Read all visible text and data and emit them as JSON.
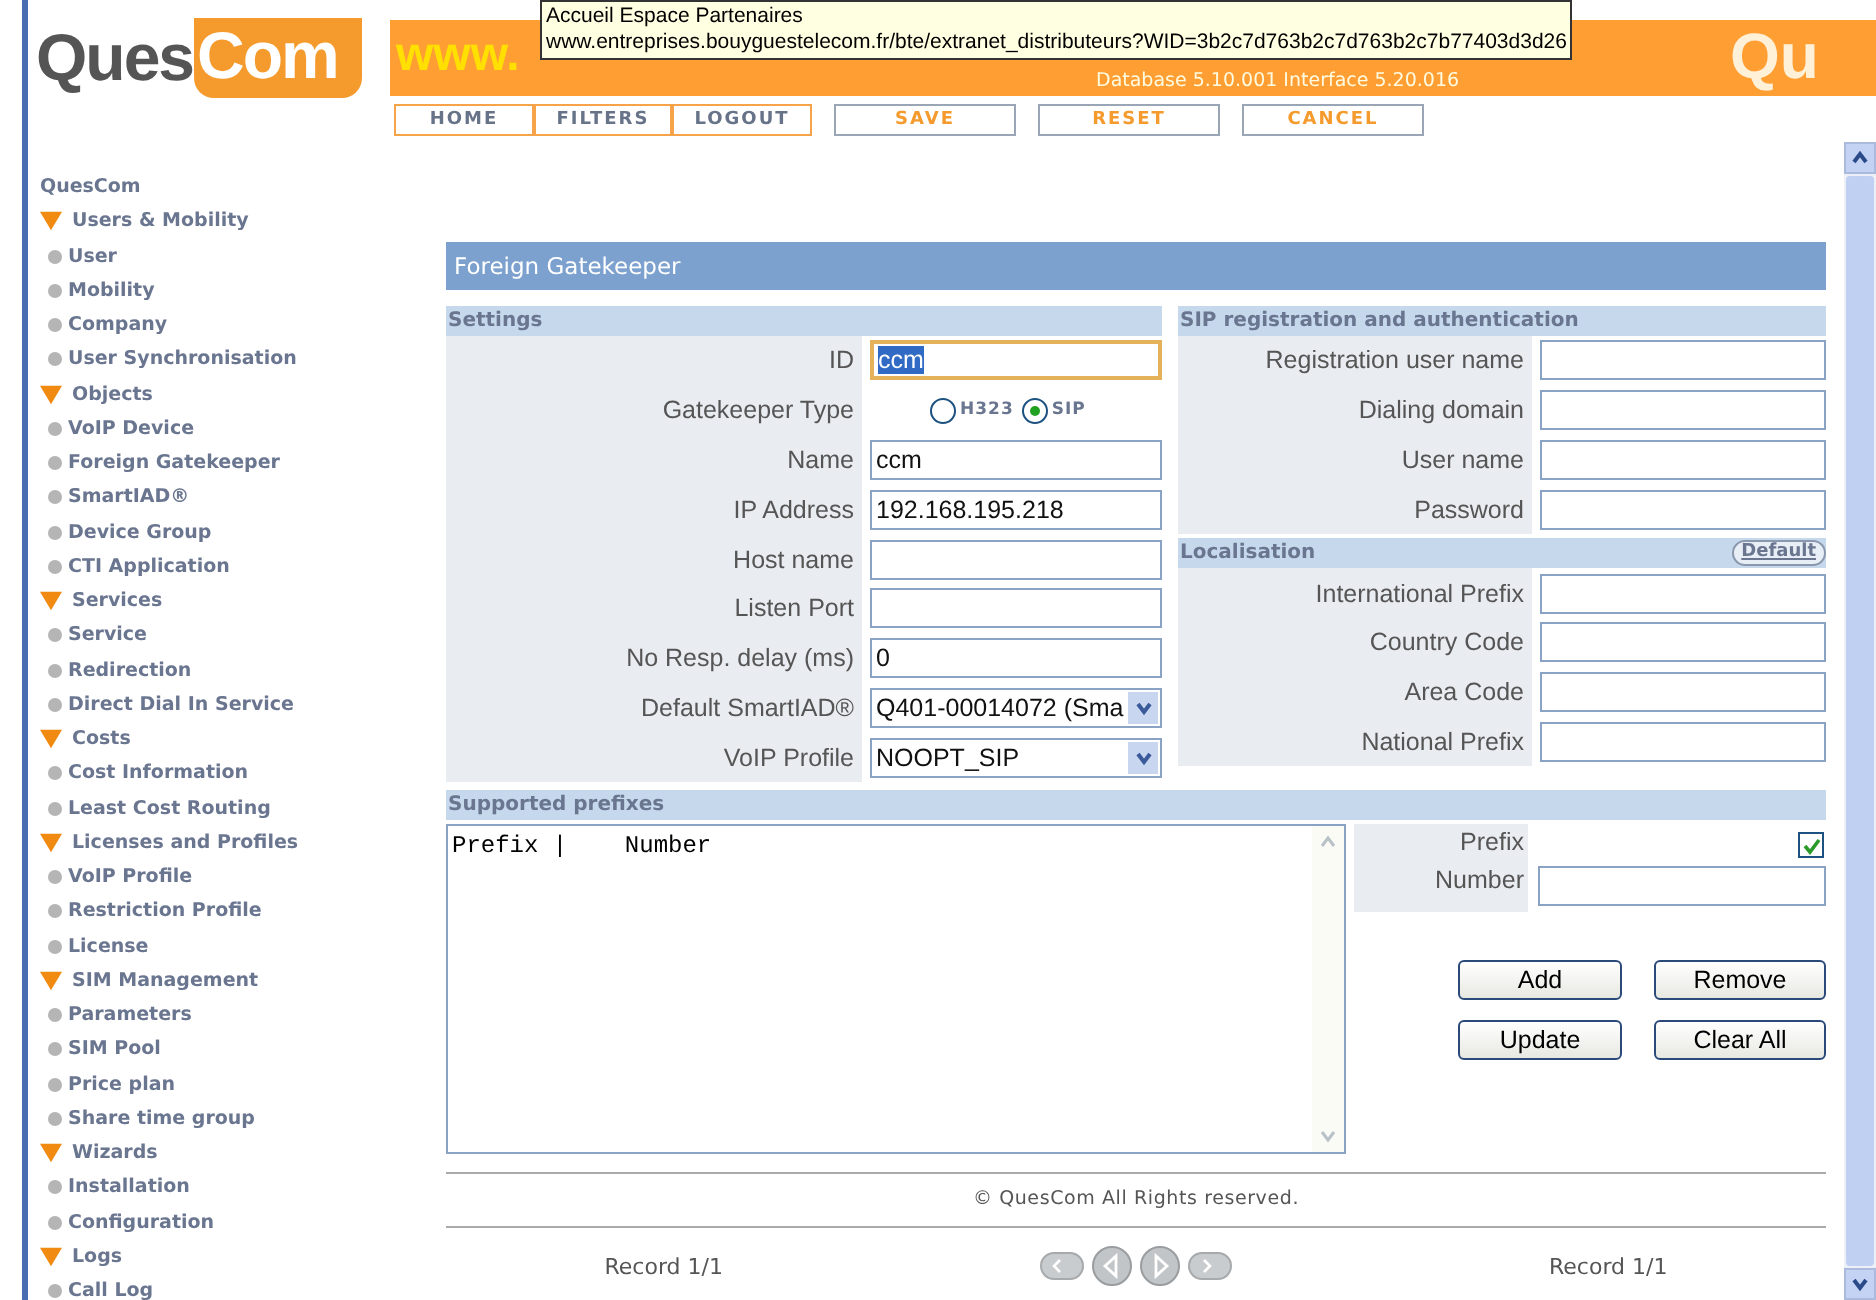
{
  "logo": {
    "first": "Ques",
    "second": "Com"
  },
  "banner": {
    "site": "www.",
    "version": "Database 5.10.001  Interface 5.20.016",
    "watermark": "Qu"
  },
  "tooltip": {
    "lines": [
      "Accueil Espace Partenaires",
      "www.entreprises.bouyguestelecom.fr/bte/extranet_distributeurs?WID=3b2c7d763b2c7d763b2c7b77403d3d26"
    ]
  },
  "nav": [
    {
      "label": "HOME",
      "kind": "nav"
    },
    {
      "label": "FILTERS",
      "kind": "nav"
    },
    {
      "label": "LOGOUT",
      "kind": "nav"
    },
    {
      "label": "SAVE",
      "kind": "action"
    },
    {
      "label": "RESET",
      "kind": "action"
    },
    {
      "label": "CANCEL",
      "kind": "action"
    }
  ],
  "sidebar": {
    "root": "QuesCom",
    "groups": [
      {
        "label": "Users & Mobility",
        "expanded": true,
        "items": [
          "User",
          "Mobility",
          "Company",
          "User Synchronisation"
        ]
      },
      {
        "label": "Objects",
        "expanded": true,
        "items": [
          "VoIP Device",
          "Foreign Gatekeeper",
          "SmartIAD®",
          "Device Group",
          "CTI Application"
        ]
      },
      {
        "label": "Services",
        "expanded": true,
        "items": [
          "Service",
          "Redirection",
          "Direct Dial In Service"
        ]
      },
      {
        "label": "Costs",
        "expanded": true,
        "items": [
          "Cost Information",
          "Least Cost Routing"
        ]
      },
      {
        "label": "Licenses and Profiles",
        "expanded": true,
        "items": [
          "VoIP Profile",
          "Restriction Profile",
          "License"
        ]
      },
      {
        "label": "SIM Management",
        "expanded": true,
        "items": [
          "Parameters",
          "SIM Pool",
          "Price plan",
          "Share time group"
        ]
      },
      {
        "label": "Wizards",
        "expanded": true,
        "items": [
          "Installation",
          "Configuration"
        ]
      },
      {
        "label": "Logs",
        "expanded": true,
        "items": [
          "Call Log"
        ]
      }
    ]
  },
  "form": {
    "title": "Foreign Gatekeeper",
    "settings": {
      "title": "Settings",
      "fields": [
        {
          "label": "ID",
          "kind": "text",
          "value": "ccm",
          "focused": true
        },
        {
          "label": "Gatekeeper Type",
          "kind": "radio",
          "options": [
            {
              "label": "H323",
              "selected": false
            },
            {
              "label": "SIP",
              "selected": true
            }
          ],
          "focused": false
        },
        {
          "label": "Name",
          "kind": "text",
          "value": "ccm",
          "focused": false
        },
        {
          "label": "IP Address",
          "kind": "text",
          "value": "192.168.195.218",
          "focused": false
        },
        {
          "label": "Host name",
          "kind": "text",
          "focused": false
        },
        {
          "label": "Listen Port",
          "kind": "text",
          "focused": false
        },
        {
          "label": "No Resp. delay (ms)",
          "kind": "text",
          "value": "0",
          "focused": false
        },
        {
          "label": "Default SmartIAD®",
          "kind": "select",
          "value": "Q401-00014072 (Sma",
          "focused": false
        },
        {
          "label": "VoIP Profile",
          "kind": "select",
          "value": "NOOPT_SIP",
          "focused": false
        }
      ]
    },
    "sip": {
      "title": "SIP registration and authentication",
      "fields": [
        {
          "label": "Registration user name"
        },
        {
          "label": "Dialing domain"
        },
        {
          "label": "User name"
        },
        {
          "label": "Password"
        }
      ]
    },
    "localisation": {
      "title": "Localisation",
      "default_button": "Default",
      "fields": [
        {
          "label": "International Prefix"
        },
        {
          "label": "Country Code"
        },
        {
          "label": "Area Code"
        },
        {
          "label": "National Prefix"
        }
      ]
    },
    "prefixes": {
      "title": "Supported prefixes",
      "list_header": "Prefix |    Number",
      "prefix_label": "Prefix",
      "prefix_checked": true,
      "number_label": "Number",
      "buttons": [
        "Add",
        "Remove",
        "Update",
        "Clear All"
      ]
    }
  },
  "footer": {
    "copyright": "© QuesCom All Rights reserved.",
    "record_left": "Record 1/1",
    "record_right": "Record 1/1"
  }
}
